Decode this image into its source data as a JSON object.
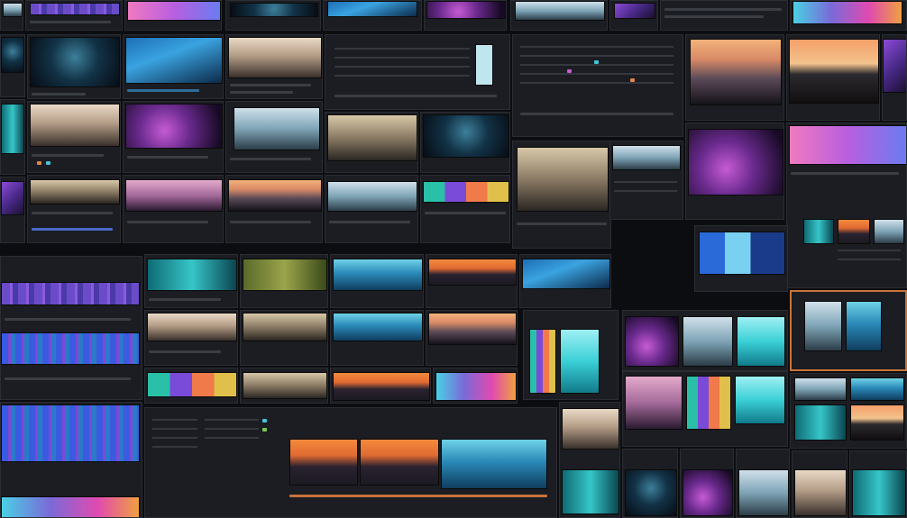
{
  "window": {
    "title": "",
    "background": "#0c0d10"
  },
  "accent": {
    "orange_border": "#c8743a",
    "playhead": "#e0864a",
    "highlight": "#43c4d8"
  },
  "icons": [
    "play-icon",
    "gear-icon",
    "scrubber-icon"
  ]
}
